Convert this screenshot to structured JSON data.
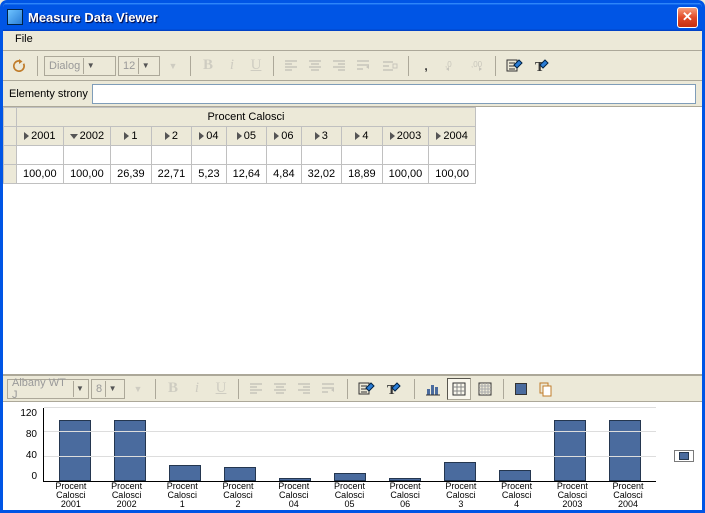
{
  "window": {
    "title": "Measure Data Viewer"
  },
  "menu": {
    "file": "File"
  },
  "toolbar1": {
    "font_combo": "Dialog",
    "size_combo": "12"
  },
  "field": {
    "label": "Elementy strony",
    "value": ""
  },
  "table": {
    "group_header": "Procent Calosci",
    "cols": [
      "2001",
      "2002",
      "1",
      "2",
      "04",
      "05",
      "06",
      "3",
      "4",
      "2003",
      "2004"
    ],
    "col_expand": [
      "r",
      "d",
      "r",
      "r",
      "r",
      "r",
      "r",
      "r",
      "r",
      "r",
      "r"
    ],
    "rows": [
      [
        "100,00",
        "100,00",
        "26,39",
        "22,71",
        "5,23",
        "12,64",
        "4,84",
        "32,02",
        "18,89",
        "100,00",
        "100,00"
      ]
    ]
  },
  "toolbar2": {
    "font_combo": "Albany WT J",
    "size_combo": "8"
  },
  "chart_data": {
    "type": "bar",
    "categories": [
      "Procent Calosci 2001",
      "Procent Calosci 2002",
      "Procent Calosci 1",
      "Procent Calosci 2",
      "Procent Calosci 04",
      "Procent Calosci 05",
      "Procent Calosci 06",
      "Procent Calosci 3",
      "Procent Calosci 4",
      "Procent Calosci 2003",
      "Procent Calosci 2004"
    ],
    "values": [
      100.0,
      100.0,
      26.39,
      22.71,
      5.23,
      12.64,
      4.84,
      32.02,
      18.89,
      100.0,
      100.0
    ],
    "title": "",
    "xlabel": "",
    "ylabel": "",
    "ylim": [
      0,
      120
    ],
    "yticks": [
      0,
      40,
      80,
      120
    ]
  },
  "colors": {
    "titlebar": "#0055e5",
    "panel": "#ece9d8",
    "bar": "#4a6b9e"
  }
}
